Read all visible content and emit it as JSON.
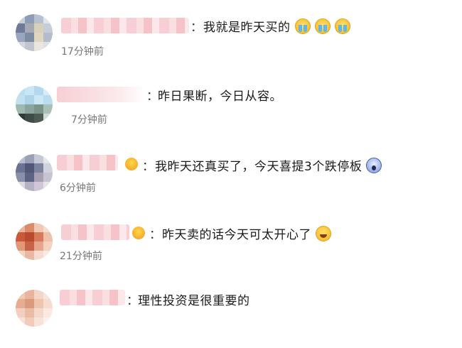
{
  "comments": [
    {
      "text": "我就是昨天买的",
      "time": "17分钟前",
      "emojis": [
        "cry-icon",
        "cry-icon",
        "cry-icon"
      ]
    },
    {
      "text": "昨日果断，今日从容。",
      "time": "7分钟前",
      "emojis": []
    },
    {
      "text": "我昨天还真买了，今天喜提3个跌停板",
      "time": "6分钟前",
      "emojis": [
        "shocked-face-icon"
      ]
    },
    {
      "text": "昨天卖的话今天可太开心了",
      "time": "21分钟前",
      "emojis": [
        "laughing-icon"
      ]
    },
    {
      "text": "理性投资是很重要的",
      "time": "",
      "emojis": []
    }
  ],
  "separator": "："
}
